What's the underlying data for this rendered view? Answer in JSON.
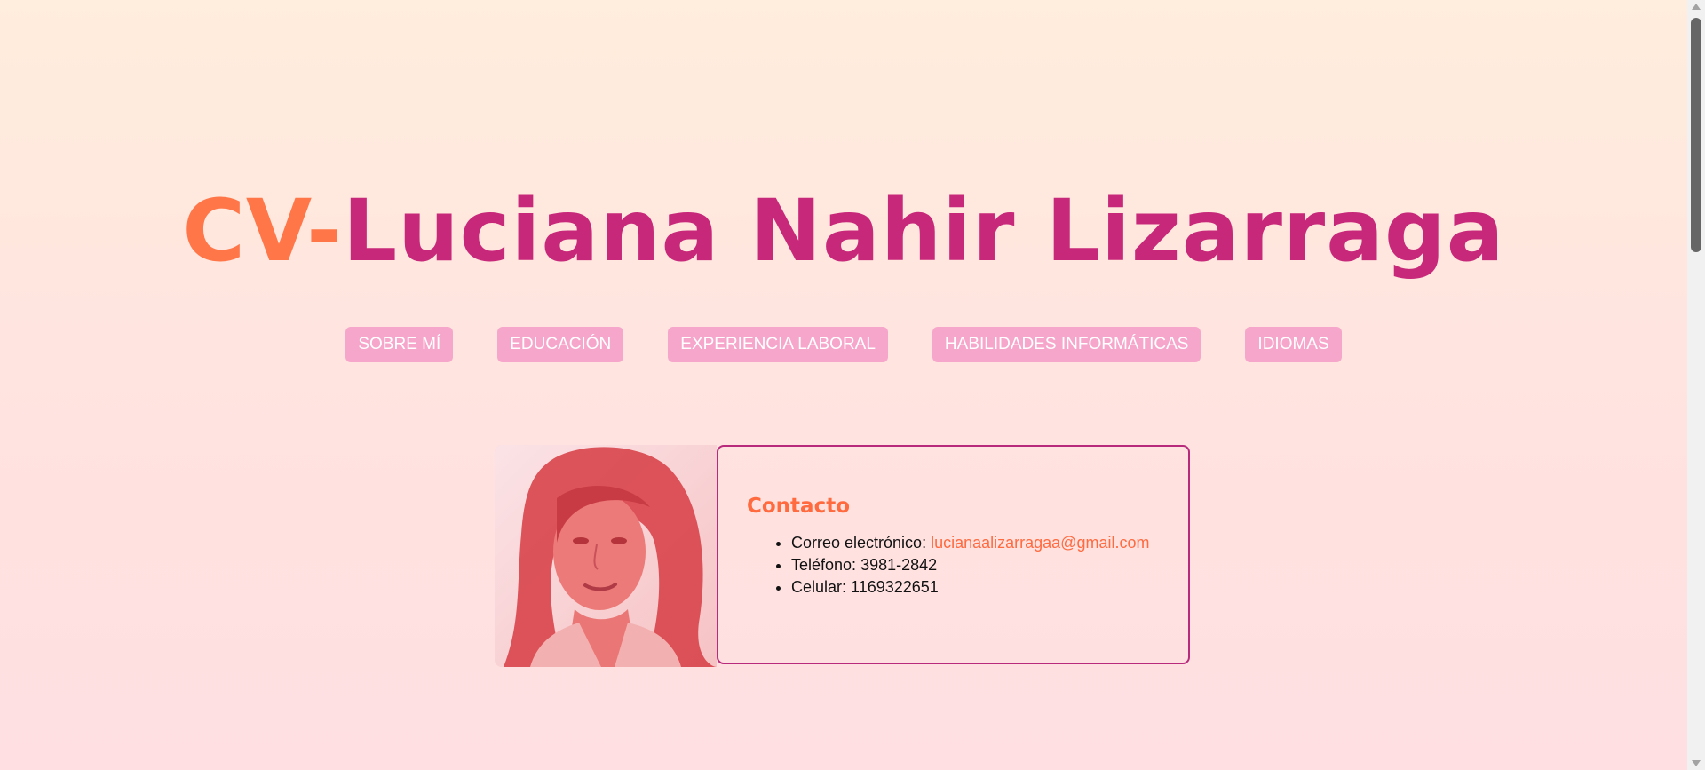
{
  "header": {
    "title_prefix": "CV-",
    "title_name": "Luciana Nahir Lizarraga"
  },
  "nav": {
    "items": [
      {
        "label": "SOBRE MÍ"
      },
      {
        "label": "EDUCACIÓN"
      },
      {
        "label": "EXPERIENCIA LABORAL"
      },
      {
        "label": "HABILIDADES INFORMÁTICAS"
      },
      {
        "label": "IDIOMAS"
      }
    ]
  },
  "contact": {
    "title": "Contacto",
    "email_label": "Correo electrónico:",
    "email_value": "lucianaalizarragaa@gmail.com",
    "phone_label": "Teléfono:",
    "phone_value": "3981-2842",
    "mobile_label": "Celular:",
    "mobile_value": "1169322651"
  },
  "colors": {
    "accent_orange": "#ff7648",
    "accent_magenta": "#c8287a",
    "nav_button_bg": "#f7a6cb",
    "card_border": "#b82b7c"
  }
}
